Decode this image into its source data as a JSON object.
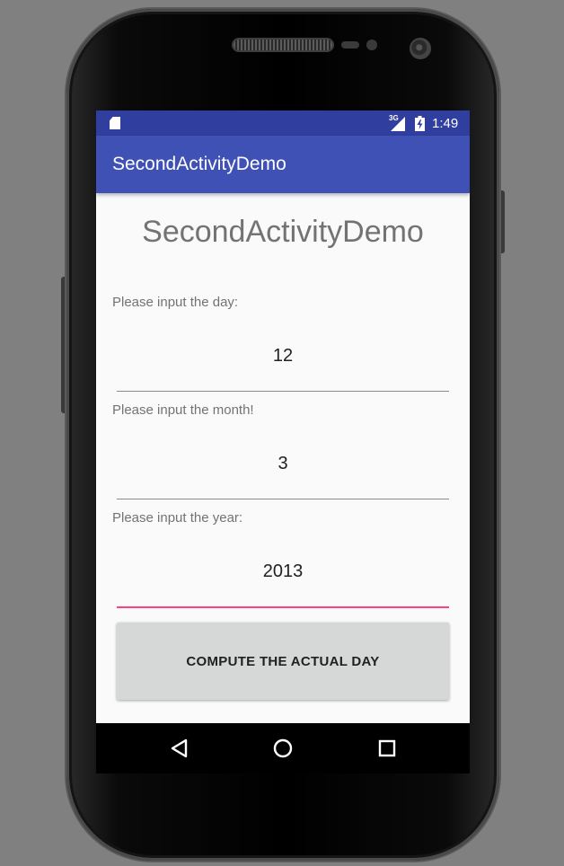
{
  "status_bar": {
    "network_type": "3G",
    "time": "1:49",
    "icons": [
      "sd-card-icon",
      "signal-icon",
      "battery-charging-icon"
    ]
  },
  "app_bar": {
    "title": "SecondActivityDemo"
  },
  "main": {
    "heading": "SecondActivityDemo",
    "fields": [
      {
        "label": "Please input the day:",
        "value": "12",
        "focused": false
      },
      {
        "label": "Please input the month!",
        "value": "3",
        "focused": false
      },
      {
        "label": "Please input the year:",
        "value": "2013",
        "focused": true
      }
    ],
    "compute_button_label": "COMPUTE THE ACTUAL DAY"
  },
  "nav_bar": {
    "buttons": [
      "back-icon",
      "home-icon",
      "recents-icon"
    ]
  },
  "colors": {
    "status_bar": "#303f9f",
    "app_bar": "#3f51b5",
    "accent": "#ff4081",
    "button": "#d6d7d7"
  }
}
